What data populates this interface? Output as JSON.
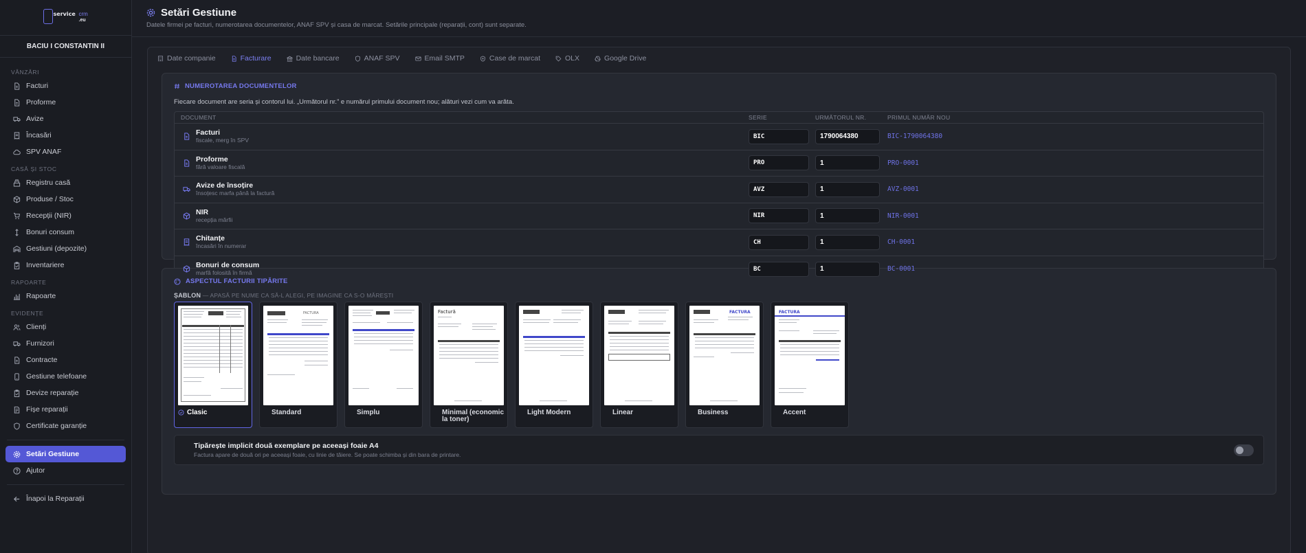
{
  "app": {
    "logo": {
      "word1": "service",
      "word2": "crm",
      "word3": ".eu"
    },
    "company": "BACIU I CONSTANTIN II"
  },
  "sidebar": {
    "sections": {
      "sales": "Vânzări",
      "cash_stock": "Casă și stoc",
      "reports": "Rapoarte",
      "records": "Evidențe"
    },
    "sales_items": [
      {
        "label": "Facturi",
        "icon": "file-icon"
      },
      {
        "label": "Proforme",
        "icon": "file-icon"
      },
      {
        "label": "Avize",
        "icon": "truck-icon"
      },
      {
        "label": "Încasări",
        "icon": "receipt-icon"
      },
      {
        "label": "SPV ANAF",
        "icon": "cloud-icon"
      }
    ],
    "stock_items": [
      {
        "label": "Registru casă",
        "icon": "register-icon"
      },
      {
        "label": "Produse / Stoc",
        "icon": "box-icon"
      },
      {
        "label": "Recepții (NIR)",
        "icon": "cart-icon"
      },
      {
        "label": "Bonuri consum",
        "icon": "arrows-icon"
      },
      {
        "label": "Gestiuni (depozite)",
        "icon": "warehouse-icon"
      },
      {
        "label": "Inventariere",
        "icon": "clipboard-icon"
      }
    ],
    "report_items": [
      {
        "label": "Rapoarte",
        "icon": "chart-icon"
      }
    ],
    "record_items": [
      {
        "label": "Clienți",
        "icon": "users-icon"
      },
      {
        "label": "Furnizori",
        "icon": "truck-icon"
      },
      {
        "label": "Contracte",
        "icon": "file-icon"
      },
      {
        "label": "Gestiune telefoane",
        "icon": "phone-icon"
      },
      {
        "label": "Devize reparație",
        "icon": "clipboard-icon"
      },
      {
        "label": "Fișe reparații",
        "icon": "wrench-icon"
      },
      {
        "label": "Certificate garanție",
        "icon": "shield-icon"
      }
    ],
    "settings": "Setări Gestiune",
    "help": "Ajutor",
    "back": "Înapoi la Reparații"
  },
  "header": {
    "title": "Setări Gestiune",
    "subtitle": "Datele firmei pe facturi, numerotarea documentelor, ANAF SPV și casa de marcat. Setările principale (reparații, cont) sunt separate."
  },
  "tabs": [
    {
      "label": "Date companie",
      "icon": "building-icon",
      "active": false
    },
    {
      "label": "Facturare",
      "icon": "file-icon",
      "active": true
    },
    {
      "label": "Date bancare",
      "icon": "bank-icon",
      "active": false
    },
    {
      "label": "ANAF SPV",
      "icon": "shield-icon",
      "active": false
    },
    {
      "label": "Email SMTP",
      "icon": "mail-icon",
      "active": false
    },
    {
      "label": "Case de marcat",
      "icon": "printer-icon",
      "active": false
    },
    {
      "label": "OLX",
      "icon": "tag-icon",
      "active": false
    },
    {
      "label": "Google Drive",
      "icon": "drive-icon",
      "active": false
    }
  ],
  "numbering": {
    "title": "Numerotarea documentelor",
    "description": "Fiecare document are seria și contorul lui. „Următorul nr.” e numărul primului document nou; alături vezi cum va arăta.",
    "columns": {
      "document": "DOCUMENT",
      "series": "SERIE",
      "next": "URMĂTORUL NR.",
      "first": "PRIMUL NUMĂR NOU"
    },
    "rows": [
      {
        "name": "Facturi",
        "sub": "fiscale, merg în SPV",
        "series": "BIC",
        "next": "1790064380",
        "preview": "BIC-1790064380",
        "icon": "file-icon"
      },
      {
        "name": "Proforme",
        "sub": "fără valoare fiscală",
        "series": "PRO",
        "next": "1",
        "preview": "PRO-0001",
        "icon": "file-icon"
      },
      {
        "name": "Avize de însoțire",
        "sub": "însoțesc marfa până la factură",
        "series": "AVZ",
        "next": "1",
        "preview": "AVZ-0001",
        "icon": "truck-icon"
      },
      {
        "name": "NIR",
        "sub": "recepția mărfii",
        "series": "NIR",
        "next": "1",
        "preview": "NIR-0001",
        "icon": "box-icon"
      },
      {
        "name": "Chitanțe",
        "sub": "încasări în numerar",
        "series": "CH",
        "next": "1",
        "preview": "CH-0001",
        "icon": "receipt-icon"
      },
      {
        "name": "Bonuri de consum",
        "sub": "marfă folosită în firmă",
        "series": "BC",
        "next": "1",
        "preview": "BC-0001",
        "icon": "box-icon"
      }
    ]
  },
  "print": {
    "title": "Aspectul facturii tipărite",
    "sablon_label": "ȘABLON",
    "sablon_hint": "— APASĂ PE NUME CA SĂ-L ALEGI, PE IMAGINE CA S-O MĂREȘTI",
    "templates": [
      {
        "label": "Clasic",
        "selected": true
      },
      {
        "label": "Standard",
        "selected": false
      },
      {
        "label": "Simplu",
        "selected": false
      },
      {
        "label": "Minimal (economic la toner)",
        "selected": false
      },
      {
        "label": "Light Modern",
        "selected": false
      },
      {
        "label": "Linear",
        "selected": false
      },
      {
        "label": "Business",
        "selected": false
      },
      {
        "label": "Accent",
        "selected": false
      }
    ],
    "thumb_texts": {
      "standard": "FACTURA",
      "minimal": "Factură",
      "business": "FACTURA",
      "accent": "FACTURA"
    },
    "option_title": "Tipărește implicit două exemplare pe aceeași foaie A4",
    "option_sub": "Factura apare de două ori pe aceeași foaie, cu linie de tăiere. Se poate schimba și din bara de printare.",
    "option_enabled": false
  },
  "colors": {
    "accent": "#5458d6",
    "accent_text": "#7679ee",
    "background": "#1c1e25"
  }
}
